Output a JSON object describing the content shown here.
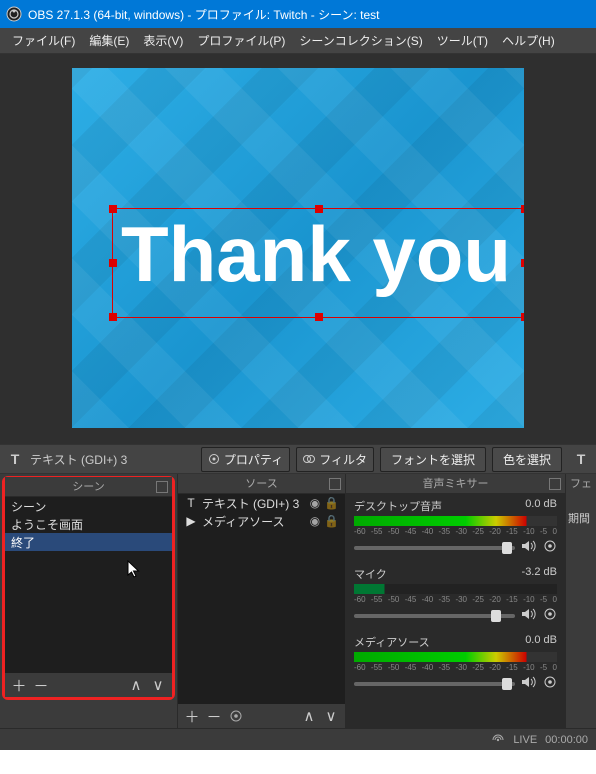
{
  "title": "OBS 27.1.3 (64-bit, windows) - プロファイル: Twitch - シーン: test",
  "menu": {
    "file": "ファイル(F)",
    "edit": "編集(E)",
    "view": "表示(V)",
    "profile": "プロファイル(P)",
    "sceneCollection": "シーンコレクション(S)",
    "tools": "ツール(T)",
    "help": "ヘルプ(H)"
  },
  "preview": {
    "text": "Thank you"
  },
  "sourceBar": {
    "selected": "テキスト (GDI+) 3",
    "properties": "プロパティ",
    "filters": "フィルタ",
    "fontSelect": "フォントを選択",
    "colorSelect": "色を選択"
  },
  "panels": {
    "scenes": {
      "title": "シーン",
      "items": [
        "シーン",
        "ようこそ画面",
        "終了"
      ],
      "selectedIndex": 2
    },
    "sources": {
      "title": "ソース",
      "items": [
        {
          "icon": "T",
          "label": "テキスト (GDI+) 3"
        },
        {
          "icon": "▶",
          "label": "メディアソース"
        }
      ]
    },
    "mixer": {
      "title": "音声ミキサー",
      "items": [
        {
          "name": "デスクトップ音声",
          "db": "0.0 dB",
          "knob": 92
        },
        {
          "name": "マイク",
          "db": "-3.2 dB",
          "knob": 85
        },
        {
          "name": "メディアソース",
          "db": "0.0 dB",
          "knob": 92
        }
      ],
      "ticks": [
        "-60",
        "-55",
        "-50",
        "-45",
        "-40",
        "-35",
        "-30",
        "-25",
        "-20",
        "-15",
        "-10",
        "-5",
        "0"
      ]
    }
  },
  "rightSlice": {
    "top": "フェ",
    "label": "期間"
  },
  "status": {
    "live": "LIVE",
    "time": "00:00:00"
  }
}
